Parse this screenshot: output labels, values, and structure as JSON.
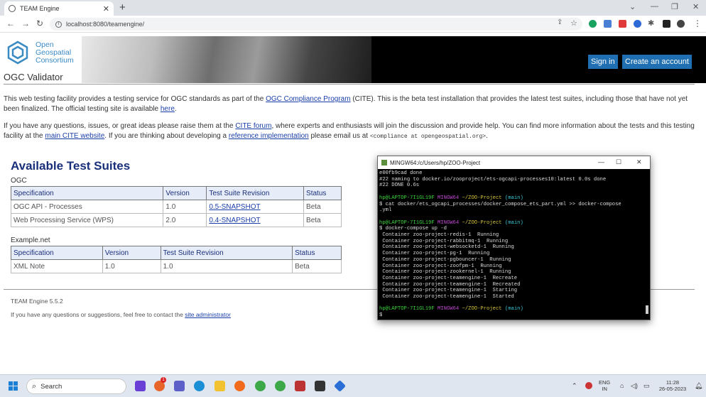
{
  "browser": {
    "tab_title": "TEAM Engine",
    "tab_close": "✕",
    "new_tab": "+",
    "url": "localhost:8080/teamengine/",
    "window_controls": [
      "⌄",
      "—",
      "❐",
      "✕"
    ]
  },
  "header": {
    "logo_lines": [
      "Open",
      "Geospatial",
      "Consortium"
    ],
    "sign_in": "Sign in",
    "create_account": "Create an account",
    "page_title": "OGC Validator"
  },
  "intro": {
    "p1_a": "This web testing facility provides a testing service for OGC standards as part of the ",
    "p1_link1": "OGC Compliance Program",
    "p1_b": " (CITE). This is the beta test installation that provides the latest test suites, including those that have not yet been finalized. The official testing site is available ",
    "p1_link2": "here",
    "p1_c": ".",
    "p2_a": "If you have any questions, issues, or great ideas please raise them at the ",
    "p2_link1": "CITE forum",
    "p2_b": ", where experts and enthusiasts will join the discussion and provide help. You can find more information about the tests and this testing facility at the ",
    "p2_link2": "main CITE website",
    "p2_c": ". If you are thinking about developing a ",
    "p2_link3": "reference implementation",
    "p2_d": " please email us at ",
    "p2_email": "<compliance at opengeospatial.org>",
    "p2_e": "."
  },
  "suites": {
    "heading": "Available Test Suites",
    "groups": [
      {
        "name": "OGC",
        "headers": [
          "Specification",
          "Version",
          "Test Suite Revision",
          "Status"
        ],
        "rows": [
          [
            "OGC API - Processes",
            "1.0",
            "0.5-SNAPSHOT",
            "Beta"
          ],
          [
            "Web Processing Service (WPS)",
            "2.0",
            "0.4-SNAPSHOT",
            "Beta"
          ]
        ]
      },
      {
        "name": "Example.net",
        "headers": [
          "Specification",
          "Version",
          "Test Suite Revision",
          "Status"
        ],
        "rows": [
          [
            "XML Note",
            "1.0",
            "1.0",
            "Beta"
          ]
        ]
      }
    ]
  },
  "footer": {
    "version": "TEAM Engine 5.5.2",
    "contact_a": "If you have any questions or suggestions, feel free to contact the ",
    "contact_link": "site administrator"
  },
  "terminal": {
    "title": "MINGW64:/c/Users/hp/ZOO-Project",
    "controls": [
      "—",
      "☐",
      "✕"
    ],
    "lines": [
      {
        "t": "e00fb9cad done",
        "c": ""
      },
      {
        "t": "#22 naming to docker.io/zooproject/ets-ogcapi-processes10:latest 0.0s done",
        "c": ""
      },
      {
        "t": "#22 DONE 0.6s",
        "c": ""
      },
      {
        "t": "",
        "c": ""
      },
      {
        "t": "hp@LAPTOP-7I1GL19F MINGW64 ~/ZOO-Project (main)",
        "c": "prompt"
      },
      {
        "t": "$ cat docker/ets_ogcapi_processes/docker_compose_ets_part.yml >> docker-compose",
        "c": ""
      },
      {
        "t": ".yml",
        "c": ""
      },
      {
        "t": "",
        "c": ""
      },
      {
        "t": "hp@LAPTOP-7I1GL19F MINGW64 ~/ZOO-Project (main)",
        "c": "prompt"
      },
      {
        "t": "$ docker-compose up -d",
        "c": ""
      },
      {
        "t": " Container zoo-project-redis-1  Running",
        "c": ""
      },
      {
        "t": " Container zoo-project-rabbitmq-1  Running",
        "c": ""
      },
      {
        "t": " Container zoo-project-websocketd-1  Running",
        "c": ""
      },
      {
        "t": " Container zoo-project-pg-1  Running",
        "c": ""
      },
      {
        "t": " Container zoo-project-pgbouncer-1  Running",
        "c": ""
      },
      {
        "t": " Container zoo-project-zoofpm-1  Running",
        "c": ""
      },
      {
        "t": " Container zoo-project-zookernel-1  Running",
        "c": ""
      },
      {
        "t": " Container zoo-project-teamengine-1  Recreate",
        "c": ""
      },
      {
        "t": " Container zoo-project-teamengine-1  Recreated",
        "c": ""
      },
      {
        "t": " Container zoo-project-teamengine-1  Starting",
        "c": ""
      },
      {
        "t": " Container zoo-project-teamengine-1  Started",
        "c": ""
      },
      {
        "t": "",
        "c": ""
      },
      {
        "t": "hp@LAPTOP-7I1GL19F MINGW64 ~/ZOO-Project (main)",
        "c": "prompt"
      },
      {
        "t": "$ ",
        "c": ""
      }
    ]
  },
  "taskbar": {
    "search": "Search",
    "lang1": "ENG",
    "lang2": "IN",
    "time": "11:28",
    "date": "26-05-2023",
    "badge": "1"
  },
  "colors": {
    "accent": "#1f6fb2",
    "heading": "#1a2f7a",
    "link": "#1a3ea8",
    "ogc_blue": "#3a8ac4"
  }
}
